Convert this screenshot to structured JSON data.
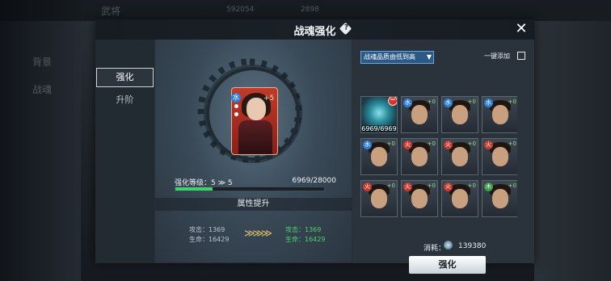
{
  "background": {
    "left_items": [
      "背景",
      "战魂"
    ],
    "top_title": "武将",
    "currency_1": "592054",
    "currency_2": "2898"
  },
  "modal": {
    "title": "战魂强化",
    "help_icon": "help-diamond-icon",
    "close_icon": "close-icon",
    "tabs": [
      {
        "label": "强化",
        "active": true
      },
      {
        "label": "升阶",
        "active": false
      }
    ]
  },
  "hero": {
    "element_badge": "水",
    "plus_level": "+5",
    "level_text": "强化等级：5 ≫ 5",
    "exp_text": "6969/28000",
    "exp_progress": 0.249,
    "attr_header": "属性提升",
    "stats_old": [
      "攻击：1369",
      "生命：16429"
    ],
    "stats_new": [
      "攻击：1369",
      "生命：16429"
    ],
    "arrows": "≫≫≫"
  },
  "materials": {
    "sort_label": "战魂品质由低到高",
    "auto_add_label": "一键添加",
    "selected_exp": "6969/6969",
    "colors": {
      "water": "#2f7fd6",
      "fire": "#c53a2e",
      "wood": "#3f9a4a"
    },
    "items": [
      {
        "type": "soul",
        "exp": "6969/6969",
        "selected": true
      },
      {
        "badge": "水",
        "plus": "+0",
        "color": "water"
      },
      {
        "badge": "水",
        "plus": "+0",
        "color": "water"
      },
      {
        "badge": "水",
        "plus": "+0",
        "color": "water"
      },
      {
        "badge": "水",
        "plus": "+0",
        "color": "water"
      },
      {
        "badge": "火",
        "plus": "+0",
        "color": "fire"
      },
      {
        "badge": "火",
        "plus": "+0",
        "color": "fire"
      },
      {
        "badge": "火",
        "plus": "+0",
        "color": "fire"
      },
      {
        "badge": "火",
        "plus": "+0",
        "color": "fire"
      },
      {
        "badge": "火",
        "plus": "+0",
        "color": "fire"
      },
      {
        "badge": "火",
        "plus": "+0",
        "color": "fire"
      },
      {
        "badge": "木",
        "plus": "+0",
        "color": "wood"
      }
    ],
    "cost_label": "消耗：",
    "cost_value": "139380",
    "confirm_label": "强化"
  }
}
